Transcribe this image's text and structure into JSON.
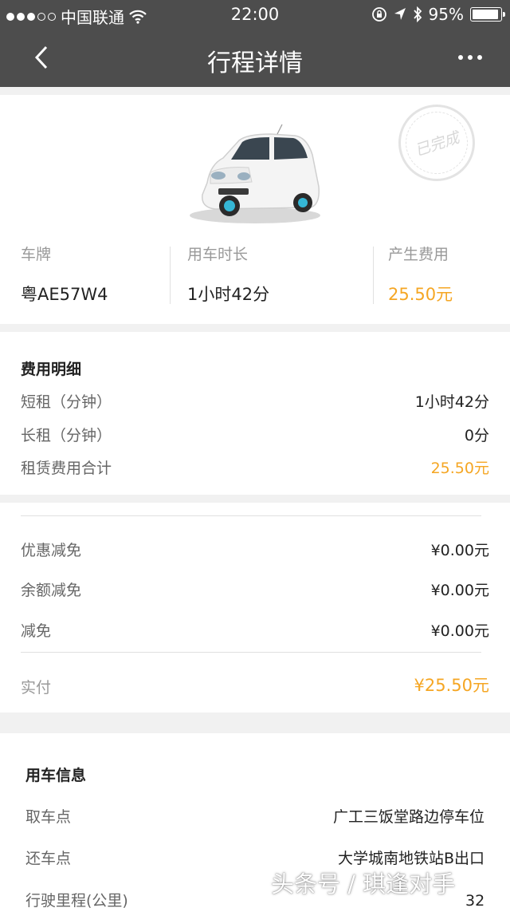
{
  "status_bar": {
    "carrier": "中国联通",
    "time": "22:00",
    "battery": "95%",
    "battery_level": 0.95
  },
  "nav": {
    "title": "行程详情"
  },
  "trip": {
    "stamp": "已完成",
    "plate_label": "车牌",
    "plate_value": "粤AE57W4",
    "duration_label": "用车时长",
    "duration_value": "1小时42分",
    "fee_label": "产生费用",
    "fee_value": "25.50元"
  },
  "fee_detail": {
    "title": "费用明细",
    "rows": [
      {
        "label": "短租（分钟）",
        "value": "1小时42分"
      },
      {
        "label": "长租（分钟）",
        "value": "0分"
      },
      {
        "label": "租赁费用合计",
        "value": "25.50元"
      }
    ]
  },
  "discounts": {
    "rows": [
      {
        "label": "优惠减免",
        "value": "¥0.00元"
      },
      {
        "label": "余额减免",
        "value": "¥0.00元"
      },
      {
        "label": "减免",
        "value": "¥0.00元"
      }
    ],
    "paid_label": "实付",
    "paid_value": "¥25.50元"
  },
  "usage": {
    "title": "用车信息",
    "rows": [
      {
        "label": "取车点",
        "value": "广工三饭堂路边停车位"
      },
      {
        "label": "还车点",
        "value": "大学城南地铁站B出口"
      },
      {
        "label": "行驶里程(公里)",
        "value": "32"
      }
    ]
  },
  "watermark": "头条号 / 琪逢对手",
  "colors": {
    "header": "#4d4d4d",
    "accent": "#f5a623"
  }
}
